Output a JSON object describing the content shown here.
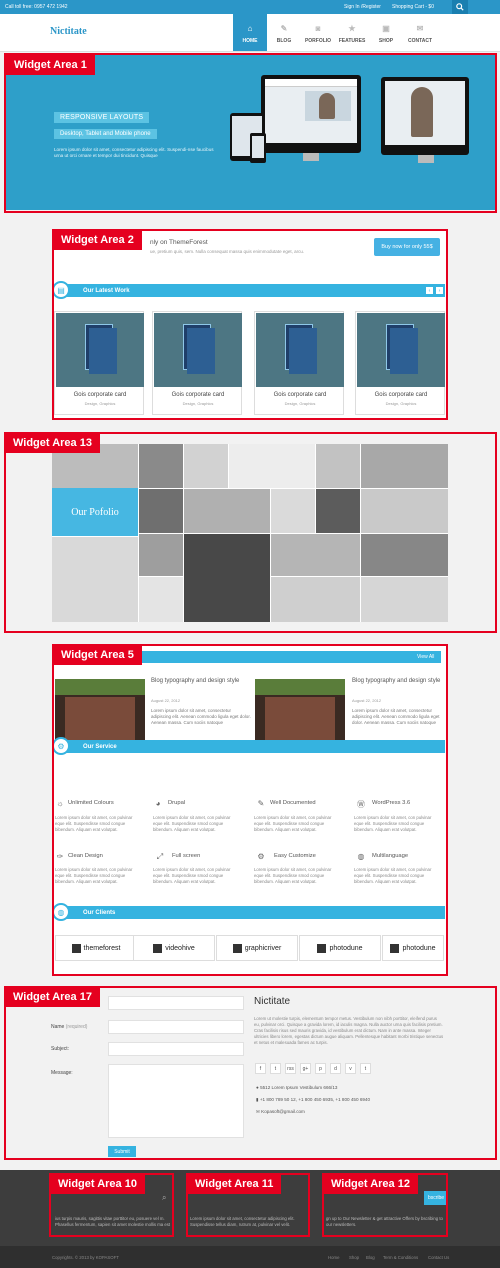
{
  "topbar": {
    "tollfree": "Call toll free: 0957 472 1942",
    "signin": "Sign In /Register",
    "cart": "Shopping Cart - $0"
  },
  "header": {
    "logo": "Nictitate"
  },
  "nav": [
    {
      "label": "HOME",
      "icon": "home-icon"
    },
    {
      "label": "BLOG",
      "icon": "pencil-icon"
    },
    {
      "label": "PORFOLIO",
      "icon": "camera-icon"
    },
    {
      "label": "FEATURES",
      "icon": "star-icon"
    },
    {
      "label": "SHOP",
      "icon": "gift-icon"
    },
    {
      "label": "CONTACT",
      "icon": "mail-icon"
    }
  ],
  "labels": {
    "wa1": "Widget Area 1",
    "wa2": "Widget Area 2",
    "wa13": "Widget Area 13",
    "wa5": "Widget Area 5",
    "wa17": "Widget Area 17",
    "wa10": "Widget Area 10",
    "wa11": "Widget Area 11",
    "wa12": "Widget Area 12"
  },
  "hero": {
    "title": "RESPONSIVE LAYOUTS",
    "subtitle": "Desktop, Tablet and  Mobile phone",
    "text": "Lorem ipsum dolor sit amet, consectetur adipiscing elit. Suspendi-nse faucibus urna ut orci ornare et tempor dui tincidunt. Quisque"
  },
  "promo": {
    "title": "nly on ThemeForest",
    "text": "ue, pretium quis, sem. Nulla consequat massa quis enimmodutate eget, arcu.",
    "button": "Buy now for only 55$"
  },
  "latest_work": {
    "title": "Our Latest Work",
    "cards": [
      {
        "title": "Gois corporate card",
        "meta": "Design, Graphics"
      },
      {
        "title": "Gois corporate card",
        "meta": "Design, Graphics"
      },
      {
        "title": "Gois corporate card",
        "meta": "Design, Graphics"
      },
      {
        "title": "Gois corporate card",
        "meta": "Design, Graphics"
      }
    ]
  },
  "portfolio": {
    "title": "Our Pofolio"
  },
  "blog": {
    "view_all": "View All",
    "posts": [
      {
        "title": "Blog typography and design style",
        "date": "August 22, 2012",
        "text": "Lorem ipsum dolor sit amet, consectetur adipiscing elit. Aenean commodo ligula eget dolor. Aenean massa. Cum sociis natoque"
      },
      {
        "title": "Blog typography and design style",
        "date": "August 22, 2012",
        "text": "Lorem ipsum dolor sit amet, consectetur adipiscing elit. Aenean commodo ligula eget dolor. Aenean massa. Cum sociis natoque"
      }
    ]
  },
  "service": {
    "title": "Our Service",
    "items": [
      {
        "title": "Unlimited Colours",
        "icon": "palette-icon",
        "text": "Lorem ipsum dolor sit amet, con pulvinar eque elit. Suspendisse smod congue bibendum. Aliquam erat volutpat."
      },
      {
        "title": "Drupal",
        "icon": "drupal-icon",
        "text": "Lorem ipsum dolor sit amet, con pulvinar eque elit. Suspendisse smod congue bibendum. Aliquam erat volutpat."
      },
      {
        "title": "Well Documented",
        "icon": "pencil-icon",
        "text": "Lorem ipsum dolor sit amet, con pulvinar eque elit. Suspendisse smod congue bibendum. Aliquam erat volutpat."
      },
      {
        "title": "WordPress 3.6",
        "icon": "wordpress-icon",
        "text": "Lorem ipsum dolor sit amet, con pulvinar eque elit. Suspendisse smod congue bibendum. Aliquam erat volutpat."
      },
      {
        "title": "Clean Design",
        "icon": "brush-icon",
        "text": "Lorem ipsum dolor sit amet, con pulvinar eque elit. Suspendisse smod congue bibendum. Aliquam erat volutpat."
      },
      {
        "title": "Full screen",
        "icon": "fullscreen-icon",
        "text": "Lorem ipsum dolor sit amet, con pulvinar eque elit. Suspendisse smod congue bibendum. Aliquam erat volutpat."
      },
      {
        "title": "Easy Customize",
        "icon": "gear-icon",
        "text": "Lorem ipsum dolor sit amet, con pulvinar eque elit. Suspendisse smod congue bibendum. Aliquam erat volutpat."
      },
      {
        "title": "Multilanguage",
        "icon": "globe-icon",
        "text": "Lorem ipsum dolor sit amet, con pulvinar eque elit. Suspendisse smod congue bibendum. Aliquam erat volutpat."
      }
    ]
  },
  "clients": {
    "title": "Our Clients",
    "items": [
      "themeforest",
      "videohive",
      "graphicriver",
      "photodune",
      "photodune"
    ]
  },
  "contact": {
    "name_label": "Name",
    "name_req": "(required)",
    "subject_label": "Subject:",
    "message_label": "Message:",
    "submit": "Submit",
    "title": "Nictitate",
    "text": "Lorem ut molestie turpis, elementum tempor metus. Vestibulum non nibh porttitor, eleifend purus eu, pulvinar orci. Quisque a gravida lorem, id iaculis magna. Nulla auctor urna quis facilisis pretium. Cras facilisis risus sed mauris gravida, id vestibulum erat dictum. Nam in ante massa. Integer ultricies libero lorem, egestas dictum augue aliquam. Pellentesque habitant morbi tristique senectus et netus et malesuada fames ac turpis.",
    "social": [
      "f",
      "t",
      "rss",
      "g+",
      "p",
      "d",
      "v",
      "t"
    ],
    "address": "5512 Lorem Ipsum Vestibulum 666/13",
    "phone": "+1 800 789 50 12, +1 800 450 6935, +1 800 450 6940",
    "email": "Kopasoft@gmail.com"
  },
  "footer": {
    "col1": "ius turpis mauris, sagittis vitae porttitor eu, posuere vel m. Phasellus fermentum, sapien sit amet molestie mollis ma est",
    "col2": "Lorem ipsum dolor sit amet, consectetur adipiscing elit. Suspendisse tellus diam, rutrum at, pulvinar vel velit.",
    "col3": "gn up to Our Newsletter & get attractive Offers by bscribing to our newsletters.",
    "subscribe": "bscribe",
    "copyright": "Copyrights. © 2013 by KOPASOFT",
    "links": [
      "Home",
      "Shop",
      "Blog",
      "Term & Conditions",
      "Contact Us"
    ]
  }
}
